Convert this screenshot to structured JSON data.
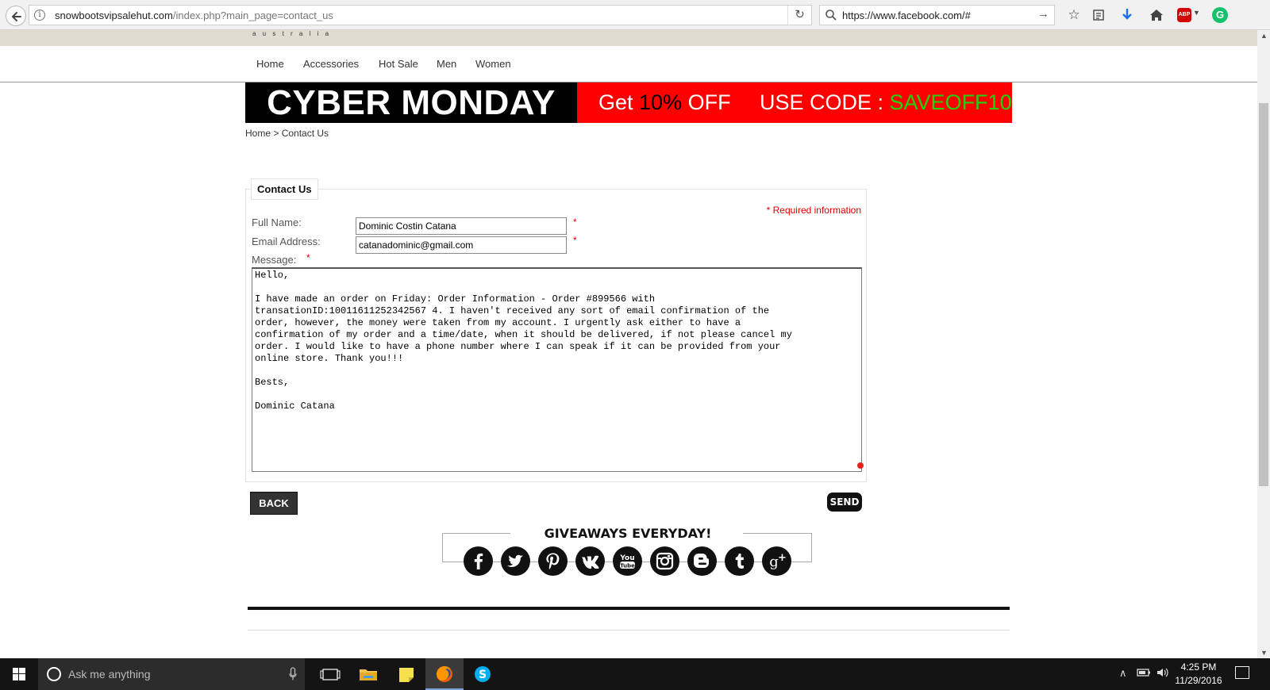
{
  "browser": {
    "url_host": "snowbootsvipsalehut.com",
    "url_path": "/index.php?main_page=contact_us",
    "search_value": "https://www.facebook.com/#",
    "abp_label": "ABP",
    "grammarly_label": "G"
  },
  "site": {
    "logo_fragment": "a u s t r a l i a",
    "nav": [
      "Home",
      "Accessories",
      "Hot Sale",
      "Men",
      "Women"
    ],
    "banner": {
      "left": "CYBER MONDAY",
      "get_prefix": "Get ",
      "get_pct": "10%",
      "get_suffix": " OFF",
      "code_prefix": "USE CODE : ",
      "code_value": "SAVEOFF10"
    },
    "breadcrumb": {
      "home": "Home",
      "sep": " > ",
      "current": "Contact Us"
    }
  },
  "contact": {
    "legend": "Contact Us",
    "required_info": "* Required information",
    "full_name_label": "Full Name:",
    "full_name_value": "Dominic Costin Catana",
    "email_label": "Email Address:",
    "email_value": "catanadominic@gmail.com",
    "message_label": "Message:",
    "required_star": "*",
    "message_value": "Hello,\n\nI have made an order on Friday: Order Information - Order #899566 with\ntransationID:10011611252342567 4. I haven't received any sort of email confirmation of the\norder, however, the money were taken from my account. I urgently ask either to have a\nconfirmation of my order and a time/date, when it should be delivered, if not please cancel my\norder. I would like to have a phone number where I can speak if it can be provided from your\nonline store. Thank you!!!\n\nBests,\n\nDominic Catana"
  },
  "buttons": {
    "back": "BACK",
    "send": "SEND"
  },
  "giveaways": {
    "title": "GIVEAWAYS EVERYDAY!",
    "icons": [
      "facebook-icon",
      "twitter-icon",
      "pinterest-icon",
      "vk-icon",
      "youtube-icon",
      "instagram-icon",
      "blogger-icon",
      "tumblr-icon",
      "google-plus-icon"
    ]
  },
  "taskbar": {
    "search_placeholder": "Ask me anything",
    "time": "4:25 PM",
    "date": "11/29/2016"
  },
  "colors": {
    "banner_red": "#ff0000",
    "banner_green": "#24d10a",
    "required_red": "#e00000"
  }
}
